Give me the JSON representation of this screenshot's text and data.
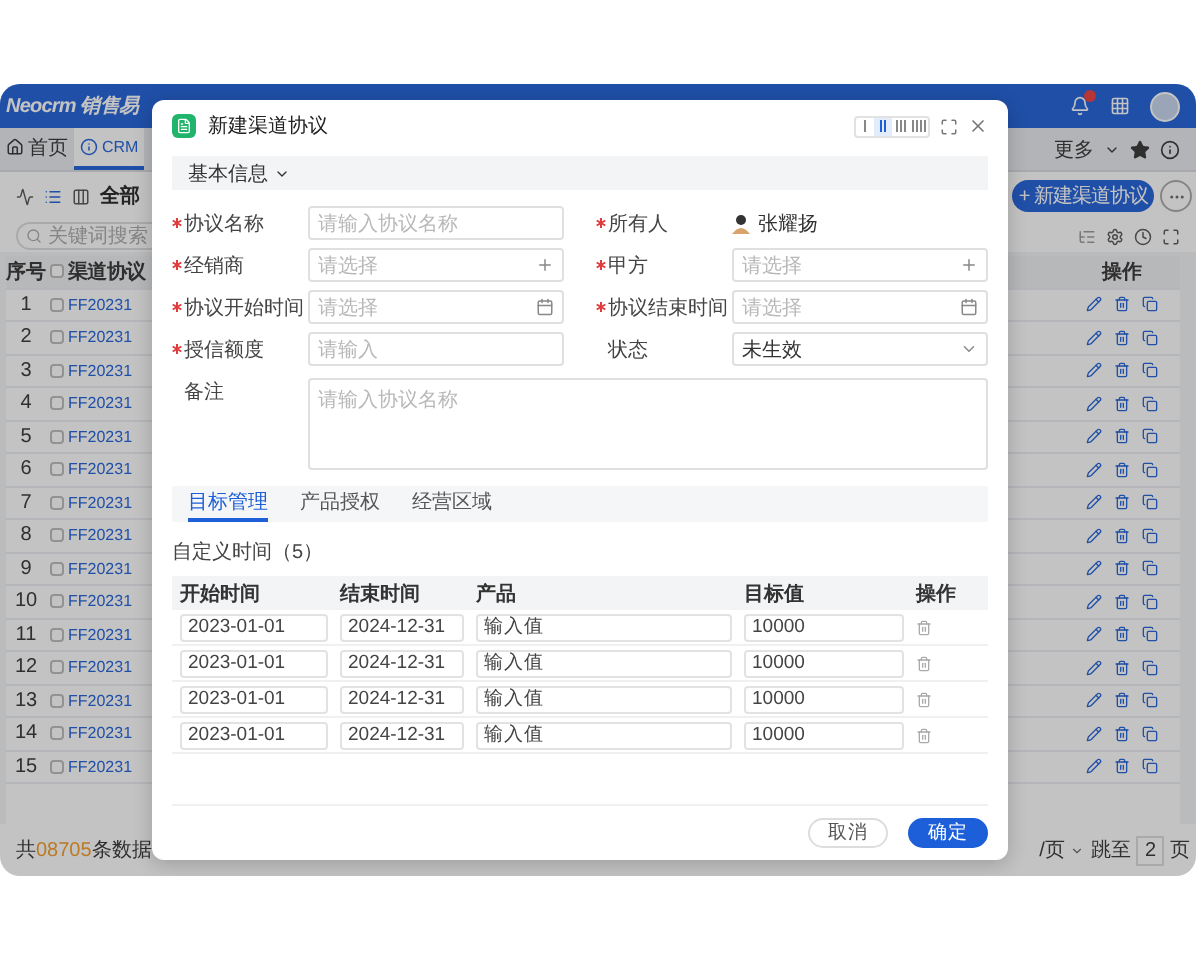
{
  "app": {
    "logo": "Neocrm 销售易",
    "notifications_badge": true,
    "tabs": [
      {
        "label": "首页",
        "kind": "home",
        "selected": false
      },
      {
        "label": "CRM",
        "kind": "module",
        "selected": true
      }
    ],
    "more_menu": "更多",
    "view_title": "全部",
    "new_button": "+ 新建渠道协议",
    "search": {
      "placeholder": "关键词搜索"
    },
    "table": {
      "columns": [
        "序号",
        "渠道协议",
        "操作"
      ],
      "select_all_checked": false,
      "rows": [
        {
          "index": "1",
          "checked": false,
          "code": "FF20231"
        },
        {
          "index": "2",
          "checked": false,
          "code": "FF20231"
        },
        {
          "index": "3",
          "checked": false,
          "code": "FF20231"
        },
        {
          "index": "4",
          "checked": false,
          "code": "FF20231"
        },
        {
          "index": "5",
          "checked": false,
          "code": "FF20231"
        },
        {
          "index": "6",
          "checked": false,
          "code": "FF20231"
        },
        {
          "index": "7",
          "checked": false,
          "code": "FF20231"
        },
        {
          "index": "8",
          "checked": false,
          "code": "FF20231"
        },
        {
          "index": "9",
          "checked": false,
          "code": "FF20231"
        },
        {
          "index": "10",
          "checked": false,
          "code": "FF20231"
        },
        {
          "index": "11",
          "checked": false,
          "code": "FF20231"
        },
        {
          "index": "12",
          "checked": false,
          "code": "FF20231"
        },
        {
          "index": "13",
          "checked": false,
          "code": "FF20231"
        },
        {
          "index": "14",
          "checked": false,
          "code": "FF20231"
        },
        {
          "index": "15",
          "checked": false,
          "code": "FF20231"
        }
      ]
    },
    "footer": {
      "total_prefix": "共",
      "total_count": "08705",
      "total_suffix": "条数据",
      "page_size": "/页",
      "jump_label": "跳至",
      "jump_value": "2",
      "page_unit": "页"
    }
  },
  "dialog": {
    "title": "新建渠道协议",
    "layout_options": [
      {
        "selected": false
      },
      {
        "selected": true
      },
      {
        "selected": false
      },
      {
        "selected": false
      }
    ],
    "section": "基本信息",
    "fields": [
      {
        "label": "协议名称",
        "required": true,
        "kind": "text",
        "placeholder": "请输入协议名称"
      },
      {
        "label": "所有人",
        "required": true,
        "kind": "user",
        "value": "张耀扬"
      },
      {
        "label": "经销商",
        "required": true,
        "kind": "lookup",
        "placeholder": "请选择"
      },
      {
        "label": "甲方",
        "required": true,
        "kind": "lookup",
        "placeholder": "请选择"
      },
      {
        "label": "协议开始时间",
        "required": true,
        "kind": "date",
        "placeholder": "请选择"
      },
      {
        "label": "协议结束时间",
        "required": true,
        "kind": "date",
        "placeholder": "请选择"
      },
      {
        "label": "授信额度",
        "required": true,
        "kind": "text",
        "placeholder": "请输入"
      },
      {
        "label": "状态",
        "required": false,
        "kind": "select",
        "value": "未生效"
      }
    ],
    "remark": {
      "label": "备注",
      "placeholder": "请输入协议名称"
    },
    "tabs": [
      {
        "label": "目标管理",
        "selected": true
      },
      {
        "label": "产品授权",
        "selected": false
      },
      {
        "label": "经营区域",
        "selected": false
      }
    ],
    "subtitle": "自定义时间（5）",
    "targets": {
      "columns": [
        "开始时间",
        "结束时间",
        "产品",
        "目标值",
        "操作"
      ],
      "rows": [
        {
          "start": "2023-01-01",
          "end": "2024-12-31",
          "product": "输入值",
          "target": "10000"
        },
        {
          "start": "2023-01-01",
          "end": "2024-12-31",
          "product": "输入值",
          "target": "10000"
        },
        {
          "start": "2023-01-01",
          "end": "2024-12-31",
          "product": "输入值",
          "target": "10000"
        },
        {
          "start": "2023-01-01",
          "end": "2024-12-31",
          "product": "输入值",
          "target": "10000"
        }
      ]
    },
    "buttons": [
      {
        "label": "取消",
        "kind": "secondary"
      },
      {
        "label": "确定",
        "kind": "primary"
      }
    ]
  }
}
